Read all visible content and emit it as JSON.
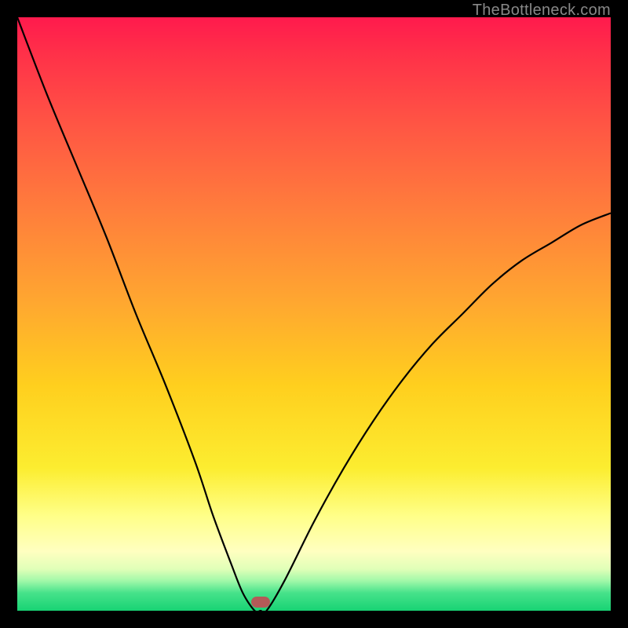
{
  "watermark": "TheBottleneck.com",
  "chart_data": {
    "type": "line",
    "title": "",
    "xlabel": "",
    "ylabel": "",
    "xlim": [
      0,
      100
    ],
    "ylim": [
      0,
      100
    ],
    "x": [
      0,
      5,
      10,
      15,
      20,
      25,
      30,
      33,
      36,
      38,
      40,
      41,
      42,
      45,
      50,
      55,
      60,
      65,
      70,
      75,
      80,
      85,
      90,
      95,
      100
    ],
    "y": [
      100,
      87,
      75,
      63,
      50,
      38,
      25,
      16,
      8,
      3,
      0,
      0,
      0,
      5,
      15,
      24,
      32,
      39,
      45,
      50,
      55,
      59,
      62,
      65,
      67
    ],
    "marker": {
      "x": 41,
      "y": 1.5
    },
    "background_gradient": {
      "direction": "vertical",
      "stops": [
        {
          "pos": 0,
          "color": "#ff1a4d"
        },
        {
          "pos": 0.5,
          "color": "#ffc020"
        },
        {
          "pos": 0.9,
          "color": "#ffffb0"
        },
        {
          "pos": 1.0,
          "color": "#18d374"
        }
      ]
    }
  }
}
